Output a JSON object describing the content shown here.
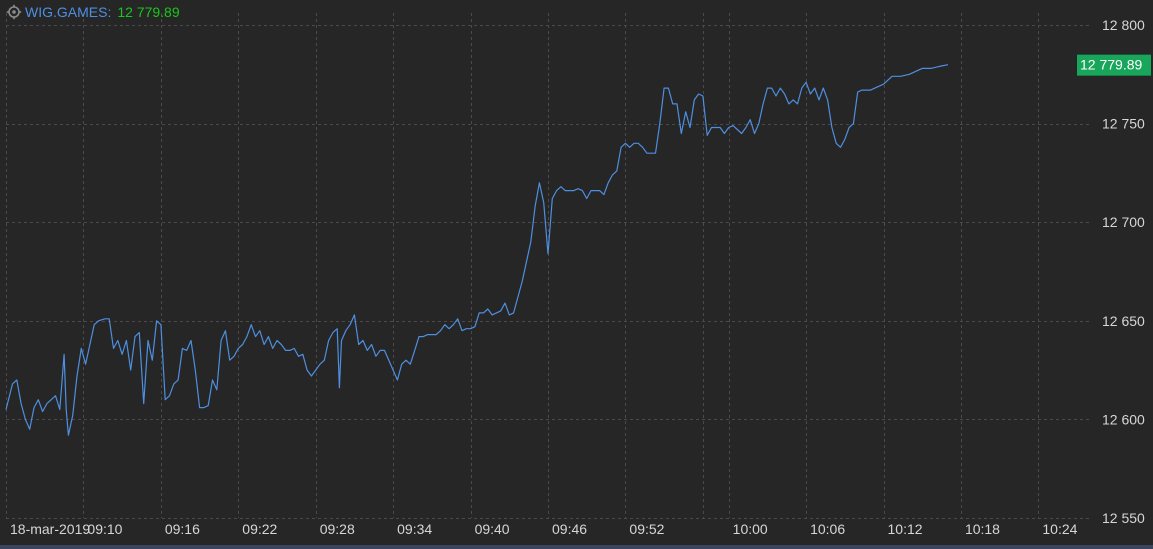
{
  "header": {
    "symbol": "WIG.GAMES:",
    "value": "12 779.89",
    "settings_icon": "settings-icon"
  },
  "colors": {
    "background": "#262626",
    "grid": "#4a4a4a",
    "line": "#4e8fe0",
    "text": "#d6d6d6",
    "last_price_badge": "#17a65a",
    "value_text": "#19c719"
  },
  "chart_data": {
    "type": "line",
    "title": "",
    "xlabel": "",
    "ylabel": "",
    "ylim": [
      12550,
      12800
    ],
    "yticks": [
      12550,
      12600,
      12650,
      12700,
      12750,
      12800
    ],
    "ytick_labels": [
      "12 550",
      "12 600",
      "12 650",
      "12 700",
      "12 750",
      "12 800"
    ],
    "x_start": "09:04",
    "x_end": "10:28",
    "xticks": [
      "09:04",
      "09:10",
      "09:16",
      "09:22",
      "09:28",
      "09:34",
      "09:40",
      "09:46",
      "09:52",
      "10:00",
      "10:06",
      "10:12",
      "10:18",
      "10:24"
    ],
    "xtick_labels": [
      "18-mar-2019",
      "09:10",
      "09:16",
      "09:22",
      "09:28",
      "09:34",
      "09:40",
      "09:46",
      "09:52",
      "10:00",
      "10:06",
      "10:12",
      "10:18",
      "10:24"
    ],
    "vertical_grid": [
      "09:04",
      "09:10",
      "09:16",
      "09:22",
      "09:28",
      "09:34",
      "09:40",
      "09:46",
      "09:52",
      "09:58",
      "10:00",
      "10:06",
      "10:12",
      "10:18",
      "10:24"
    ],
    "grid": true,
    "last_value": 12779.89,
    "last_value_label": "12 779.89",
    "series": [
      {
        "values": [
          [
            "09:04:00",
            12605
          ],
          [
            "09:04:30",
            12618
          ],
          [
            "09:04:50",
            12620
          ],
          [
            "09:05:10",
            12608
          ],
          [
            "09:05:30",
            12600
          ],
          [
            "09:05:50",
            12595
          ],
          [
            "09:06:10",
            12606
          ],
          [
            "09:06:30",
            12610
          ],
          [
            "09:06:50",
            12604
          ],
          [
            "09:07:10",
            12608
          ],
          [
            "09:07:30",
            12610
          ],
          [
            "09:07:50",
            12612
          ],
          [
            "09:08:10",
            12605
          ],
          [
            "09:08:30",
            12633
          ],
          [
            "09:08:40",
            12605
          ],
          [
            "09:08:50",
            12592
          ],
          [
            "09:09:10",
            12602
          ],
          [
            "09:09:30",
            12622
          ],
          [
            "09:09:50",
            12636
          ],
          [
            "09:10:10",
            12628
          ],
          [
            "09:10:30",
            12638
          ],
          [
            "09:10:50",
            12648
          ],
          [
            "09:11:10",
            12650
          ],
          [
            "09:11:40",
            12651
          ],
          [
            "09:12:00",
            12651
          ],
          [
            "09:12:20",
            12636
          ],
          [
            "09:12:40",
            12640
          ],
          [
            "09:13:00",
            12633
          ],
          [
            "09:13:20",
            12640
          ],
          [
            "09:13:40",
            12625
          ],
          [
            "09:14:00",
            12642
          ],
          [
            "09:14:20",
            12644
          ],
          [
            "09:14:40",
            12608
          ],
          [
            "09:15:00",
            12640
          ],
          [
            "09:15:20",
            12630
          ],
          [
            "09:15:40",
            12650
          ],
          [
            "09:16:00",
            12648
          ],
          [
            "09:16:20",
            12610
          ],
          [
            "09:16:40",
            12612
          ],
          [
            "09:17:00",
            12618
          ],
          [
            "09:17:20",
            12620
          ],
          [
            "09:17:40",
            12636
          ],
          [
            "09:18:00",
            12635
          ],
          [
            "09:18:20",
            12640
          ],
          [
            "09:18:40",
            12625
          ],
          [
            "09:19:00",
            12606
          ],
          [
            "09:19:20",
            12606
          ],
          [
            "09:19:40",
            12607
          ],
          [
            "09:20:00",
            12620
          ],
          [
            "09:20:20",
            12615
          ],
          [
            "09:20:40",
            12640
          ],
          [
            "09:21:00",
            12645
          ],
          [
            "09:21:20",
            12630
          ],
          [
            "09:21:40",
            12632
          ],
          [
            "09:22:00",
            12636
          ],
          [
            "09:22:20",
            12638
          ],
          [
            "09:22:40",
            12642
          ],
          [
            "09:23:00",
            12648
          ],
          [
            "09:23:20",
            12642
          ],
          [
            "09:23:40",
            12645
          ],
          [
            "09:24:00",
            12638
          ],
          [
            "09:24:20",
            12642
          ],
          [
            "09:24:40",
            12636
          ],
          [
            "09:25:00",
            12640
          ],
          [
            "09:25:20",
            12638
          ],
          [
            "09:25:40",
            12635
          ],
          [
            "09:26:00",
            12635
          ],
          [
            "09:26:20",
            12636
          ],
          [
            "09:26:40",
            12632
          ],
          [
            "09:27:00",
            12633
          ],
          [
            "09:27:20",
            12625
          ],
          [
            "09:27:40",
            12622
          ],
          [
            "09:28:00",
            12625
          ],
          [
            "09:28:20",
            12628
          ],
          [
            "09:28:40",
            12630
          ],
          [
            "09:29:00",
            12640
          ],
          [
            "09:29:20",
            12644
          ],
          [
            "09:29:40",
            12646
          ],
          [
            "09:29:50",
            12616
          ],
          [
            "09:30:00",
            12640
          ],
          [
            "09:30:20",
            12645
          ],
          [
            "09:30:40",
            12648
          ],
          [
            "09:31:00",
            12653
          ],
          [
            "09:31:20",
            12638
          ],
          [
            "09:31:40",
            12640
          ],
          [
            "09:32:00",
            12635
          ],
          [
            "09:32:20",
            12638
          ],
          [
            "09:32:40",
            12632
          ],
          [
            "09:33:00",
            12635
          ],
          [
            "09:33:20",
            12635
          ],
          [
            "09:33:40",
            12630
          ],
          [
            "09:34:00",
            12625
          ],
          [
            "09:34:20",
            12620
          ],
          [
            "09:34:40",
            12628
          ],
          [
            "09:35:00",
            12630
          ],
          [
            "09:35:20",
            12628
          ],
          [
            "09:35:40",
            12635
          ],
          [
            "09:36:00",
            12642
          ],
          [
            "09:36:20",
            12642
          ],
          [
            "09:36:40",
            12643
          ],
          [
            "09:37:00",
            12643
          ],
          [
            "09:37:20",
            12643
          ],
          [
            "09:37:40",
            12645
          ],
          [
            "09:38:00",
            12648
          ],
          [
            "09:38:20",
            12646
          ],
          [
            "09:38:40",
            12648
          ],
          [
            "09:39:00",
            12651
          ],
          [
            "09:39:20",
            12645
          ],
          [
            "09:39:40",
            12646
          ],
          [
            "09:40:00",
            12646
          ],
          [
            "09:40:20",
            12647
          ],
          [
            "09:40:40",
            12654
          ],
          [
            "09:41:00",
            12654
          ],
          [
            "09:41:20",
            12656
          ],
          [
            "09:41:40",
            12653
          ],
          [
            "09:42:00",
            12654
          ],
          [
            "09:42:20",
            12655
          ],
          [
            "09:42:40",
            12659
          ],
          [
            "09:43:00",
            12653
          ],
          [
            "09:43:20",
            12654
          ],
          [
            "09:43:40",
            12662
          ],
          [
            "09:44:00",
            12670
          ],
          [
            "09:44:20",
            12680
          ],
          [
            "09:44:40",
            12690
          ],
          [
            "09:45:00",
            12708
          ],
          [
            "09:45:20",
            12720
          ],
          [
            "09:45:40",
            12710
          ],
          [
            "09:46:00",
            12684
          ],
          [
            "09:46:20",
            12712
          ],
          [
            "09:46:40",
            12716
          ],
          [
            "09:47:00",
            12718
          ],
          [
            "09:47:20",
            12716
          ],
          [
            "09:47:40",
            12716
          ],
          [
            "09:48:00",
            12716
          ],
          [
            "09:48:20",
            12717
          ],
          [
            "09:48:40",
            12716
          ],
          [
            "09:49:00",
            12712
          ],
          [
            "09:49:20",
            12716
          ],
          [
            "09:49:40",
            12716
          ],
          [
            "09:50:00",
            12716
          ],
          [
            "09:50:20",
            12714
          ],
          [
            "09:50:40",
            12720
          ],
          [
            "09:51:00",
            12724
          ],
          [
            "09:51:20",
            12726
          ],
          [
            "09:51:40",
            12738
          ],
          [
            "09:52:00",
            12740
          ],
          [
            "09:52:20",
            12738
          ],
          [
            "09:52:40",
            12740
          ],
          [
            "09:53:00",
            12740
          ],
          [
            "09:53:20",
            12738
          ],
          [
            "09:53:40",
            12735
          ],
          [
            "09:54:00",
            12735
          ],
          [
            "09:54:20",
            12735
          ],
          [
            "09:54:40",
            12750
          ],
          [
            "09:55:00",
            12768
          ],
          [
            "09:55:20",
            12768
          ],
          [
            "09:55:40",
            12760
          ],
          [
            "09:56:00",
            12760
          ],
          [
            "09:56:20",
            12745
          ],
          [
            "09:56:40",
            12756
          ],
          [
            "09:57:00",
            12748
          ],
          [
            "09:57:20",
            12762
          ],
          [
            "09:57:40",
            12765
          ],
          [
            "09:58:00",
            12764
          ],
          [
            "09:58:20",
            12744
          ],
          [
            "09:58:40",
            12748
          ],
          [
            "09:59:00",
            12748
          ],
          [
            "09:59:20",
            12748
          ],
          [
            "09:59:40",
            12745
          ],
          [
            "10:00:00",
            12748
          ],
          [
            "10:00:20",
            12749
          ],
          [
            "10:00:40",
            12747
          ],
          [
            "10:01:00",
            12745
          ],
          [
            "10:01:20",
            12748
          ],
          [
            "10:01:40",
            12752
          ],
          [
            "10:02:00",
            12745
          ],
          [
            "10:02:20",
            12750
          ],
          [
            "10:02:40",
            12760
          ],
          [
            "10:03:00",
            12768
          ],
          [
            "10:03:20",
            12768
          ],
          [
            "10:03:40",
            12764
          ],
          [
            "10:04:00",
            12768
          ],
          [
            "10:04:20",
            12765
          ],
          [
            "10:04:40",
            12760
          ],
          [
            "10:05:00",
            12762
          ],
          [
            "10:05:20",
            12760
          ],
          [
            "10:05:40",
            12768
          ],
          [
            "10:06:00",
            12771
          ],
          [
            "10:06:20",
            12765
          ],
          [
            "10:06:40",
            12768
          ],
          [
            "10:07:00",
            12762
          ],
          [
            "10:07:20",
            12768
          ],
          [
            "10:07:40",
            12762
          ],
          [
            "10:08:00",
            12748
          ],
          [
            "10:08:20",
            12740
          ],
          [
            "10:08:40",
            12738
          ],
          [
            "10:09:00",
            12742
          ],
          [
            "10:09:20",
            12748
          ],
          [
            "10:09:40",
            12750
          ],
          [
            "10:10:00",
            12766
          ],
          [
            "10:10:20",
            12767
          ],
          [
            "10:10:40",
            12767
          ],
          [
            "10:11:00",
            12767
          ],
          [
            "10:11:20",
            12768
          ],
          [
            "10:12:00",
            12770
          ],
          [
            "10:12:40",
            12774
          ],
          [
            "10:13:20",
            12774
          ],
          [
            "10:14:00",
            12775
          ],
          [
            "10:15:00",
            12778
          ],
          [
            "10:15:40",
            12778
          ],
          [
            "10:16:20",
            12779
          ],
          [
            "10:17:00",
            12779.89
          ]
        ]
      }
    ]
  }
}
